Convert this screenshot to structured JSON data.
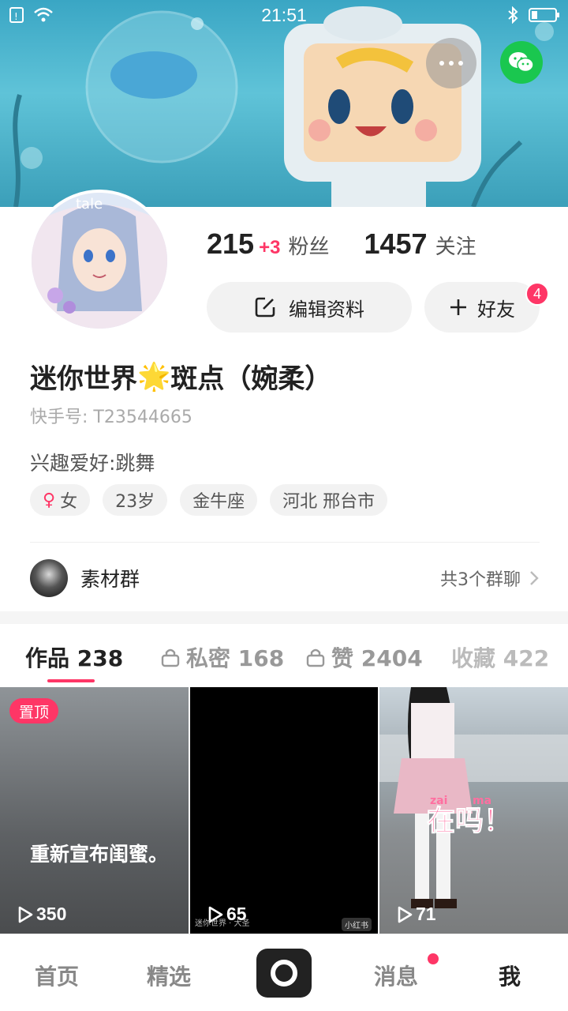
{
  "status_bar": {
    "time": "21:51"
  },
  "profile": {
    "followers_count": "215",
    "followers_increment": "+3",
    "followers_label": "粉丝",
    "following_count": "1457",
    "following_label": "关注",
    "edit_button_label": "编辑资料",
    "friend_button_label": "好友",
    "friend_badge": "4",
    "name_part1": "迷你世界",
    "name_emoji": "🌟",
    "name_part2": "斑点（婉柔）",
    "kuaishou_id": "快手号: T23544665",
    "bio": "兴趣爱好:跳舞",
    "tags": {
      "gender_symbol": "♀",
      "gender": "女",
      "age": "23岁",
      "zodiac": "金牛座",
      "location": "河北 邢台市"
    },
    "avatar_text": "tale"
  },
  "group": {
    "name": "素材群",
    "count_text": "共3个群聊"
  },
  "tabs": [
    {
      "label": "作品 238"
    },
    {
      "label": "私密 168"
    },
    {
      "label": "赞 2404"
    },
    {
      "label": "收藏 422"
    }
  ],
  "videos": [
    {
      "pinned_label": "置顶",
      "caption": "重新宣布闺蜜。",
      "plays": "350"
    },
    {
      "plays": "65",
      "watermark": "迷你世界 · 大圣",
      "watermark2": "小红书"
    },
    {
      "plays": "71",
      "sticker": "在吗！",
      "sticker_pinyin_1": "zai",
      "sticker_pinyin_2": "ma"
    }
  ],
  "bottom_nav": {
    "home": "首页",
    "featured": "精选",
    "messages": "消息",
    "me": "我"
  },
  "colors": {
    "accent": "#fe3666",
    "wechat": "#1ac74f",
    "banner": "#3aa6c4"
  },
  "icons": [
    "wifi-icon",
    "battery-icon",
    "bluetooth-icon",
    "more-icon",
    "wechat-icon",
    "edit-icon",
    "plus-icon",
    "female-icon",
    "chevron-right-icon",
    "lock-icon",
    "play-icon",
    "camera-icon"
  ]
}
